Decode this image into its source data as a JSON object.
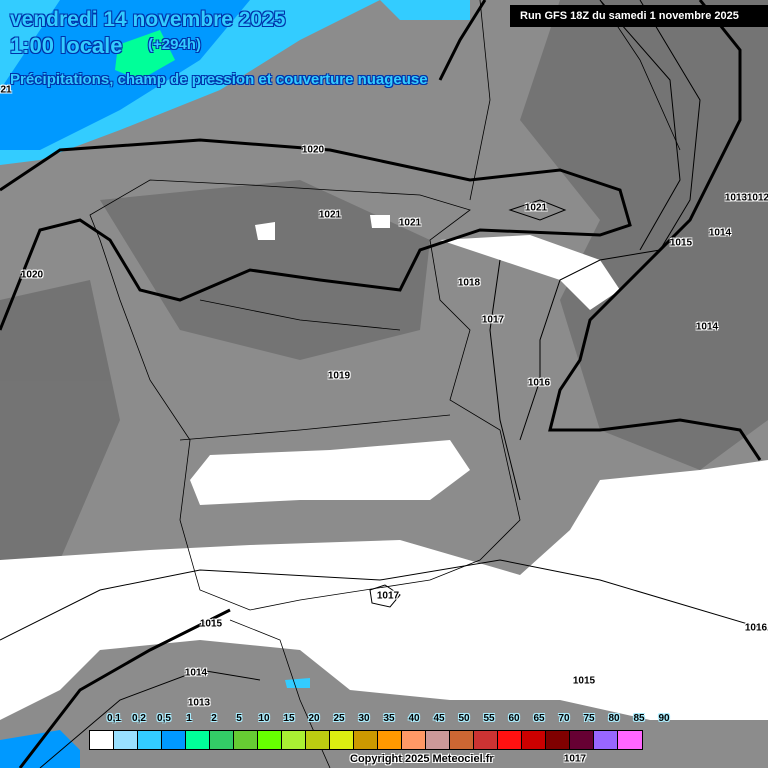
{
  "header": {
    "date": "vendredi 14 novembre 2025",
    "time": "1:00 locale",
    "lead": "(+294h)",
    "subtitle": "Précipitations, champ de pression et couverture nuageuse",
    "run": "Run GFS 18Z du samedi 1 novembre 2025"
  },
  "isobar_labels": [
    "1020",
    "1021",
    "1021",
    "1021",
    "1020",
    "1018",
    "1017",
    "1019",
    "1016",
    "1013",
    "1012",
    "1014",
    "1015",
    "1014",
    "1017",
    "1015",
    "1016",
    "1014",
    "1015",
    "1013",
    "1017",
    "21"
  ],
  "legend": {
    "labels": [
      "0,1",
      "0,2",
      "0,5",
      "1",
      "2",
      "5",
      "10",
      "15",
      "20",
      "25",
      "30",
      "35",
      "40",
      "45",
      "50",
      "55",
      "60",
      "65",
      "70",
      "75",
      "80",
      "85",
      "90"
    ],
    "colors": [
      "#ffffff",
      "#99e0ff",
      "#33ccff",
      "#0099ff",
      "#00ff99",
      "#33cc66",
      "#66cc33",
      "#66ff00",
      "#aaf033",
      "#bbcc11",
      "#ddee11",
      "#cc9900",
      "#ff9900",
      "#ff9966",
      "#cc9999",
      "#cc6633",
      "#cc3333",
      "#ff1111",
      "#cc0000",
      "#800000",
      "#660033",
      "#9966ff",
      "#ff66ff"
    ]
  },
  "copyright": "Copyright 2025 Meteociel.fr"
}
